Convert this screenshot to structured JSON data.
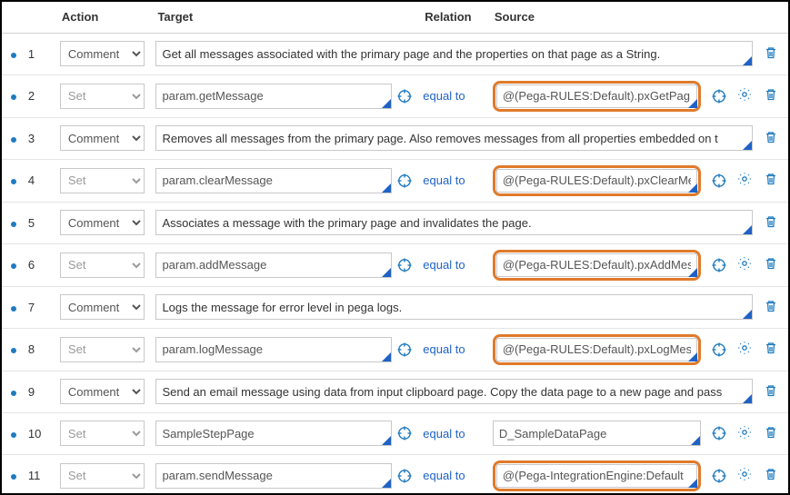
{
  "headers": {
    "action": "Action",
    "target": "Target",
    "relation": "Relation",
    "source": "Source"
  },
  "actions": {
    "comment": "Comment",
    "set": "Set"
  },
  "relation": {
    "equal_to": "equal to"
  },
  "rows": [
    {
      "n": "1",
      "type": "comment",
      "text": "Get all messages associated with the primary page and the properties on that page as a String."
    },
    {
      "n": "2",
      "type": "set",
      "target": "param.getMessage",
      "source": "@(Pega-RULES:Default).pxGetPag",
      "highlight": true,
      "gear": true
    },
    {
      "n": "3",
      "type": "comment",
      "text": "Removes all messages from the primary page. Also removes messages from all properties embedded on t"
    },
    {
      "n": "4",
      "type": "set",
      "target": "param.clearMessage",
      "source": "@(Pega-RULES:Default).pxClearMe",
      "highlight": true,
      "gear": true
    },
    {
      "n": "5",
      "type": "comment",
      "text": "Associates a message with the primary page and invalidates the page."
    },
    {
      "n": "6",
      "type": "set",
      "target": "param.addMessage",
      "source": "@(Pega-RULES:Default).pxAddMes",
      "highlight": true,
      "gear": true
    },
    {
      "n": "7",
      "type": "comment",
      "text": "Logs the message for error level in pega logs."
    },
    {
      "n": "8",
      "type": "set",
      "target": "param.logMessage",
      "source": "@(Pega-RULES:Default).pxLogMes",
      "highlight": true,
      "gear": true
    },
    {
      "n": "9",
      "type": "comment",
      "text": "Send an email message using data from input clipboard page. Copy the data page to a new page and pass"
    },
    {
      "n": "10",
      "type": "set",
      "target": "SampleStepPage",
      "source": "D_SampleDataPage",
      "highlight": false,
      "gear": true
    },
    {
      "n": "11",
      "type": "set",
      "target": "param.sendMessage",
      "source": "@(Pega-IntegrationEngine:Default",
      "highlight": true,
      "gear": true
    }
  ]
}
